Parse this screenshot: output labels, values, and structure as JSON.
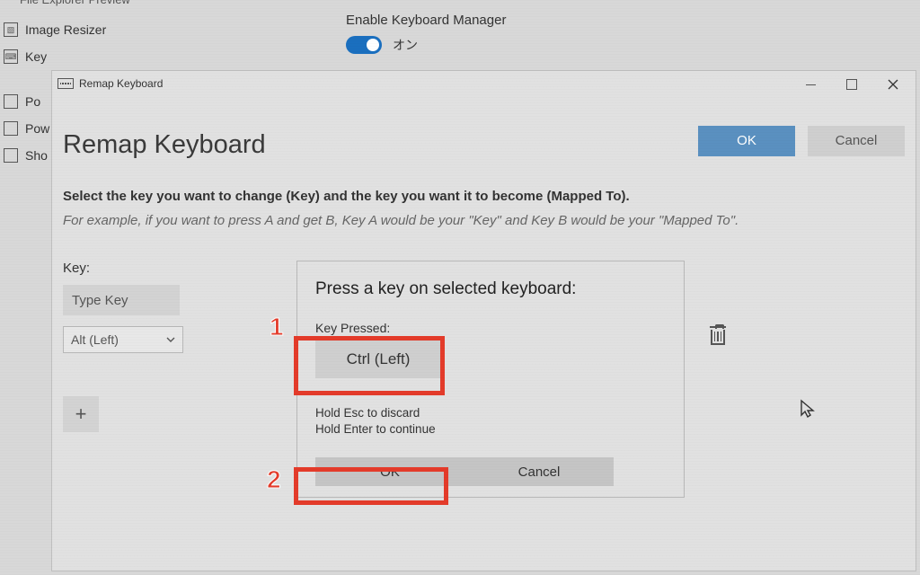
{
  "bg": {
    "top_sidebar_item": "File Explorer Preview",
    "sidebar": {
      "image_resizer": "Image Resizer",
      "key": "Key",
      "pow1": "Po",
      "pow2": "Pow",
      "sho": "Sho"
    },
    "setting_title": "Enable Keyboard Manager",
    "toggle_state": "オン"
  },
  "window": {
    "title": "Remap Keyboard",
    "heading": "Remap Keyboard",
    "ok": "OK",
    "cancel": "Cancel",
    "instruction": "Select the key you want to change (Key) and the key you want it to become (Mapped To).",
    "example": "For example, if you want to press A and get B, Key A would be your \"Key\" and Key B would be your \"Mapped To\".",
    "key_label": "Key:",
    "type_key": "Type Key",
    "selected_key": "Alt (Left)",
    "add": "+"
  },
  "capture": {
    "title": "Press a key on selected keyboard:",
    "key_pressed_label": "Key Pressed:",
    "key_pressed_value": "Ctrl (Left)",
    "hint1": "Hold Esc to discard",
    "hint2": "Hold Enter to continue",
    "ok": "OK",
    "cancel": "Cancel"
  },
  "annotations": {
    "n1": "1",
    "n2": "2"
  }
}
